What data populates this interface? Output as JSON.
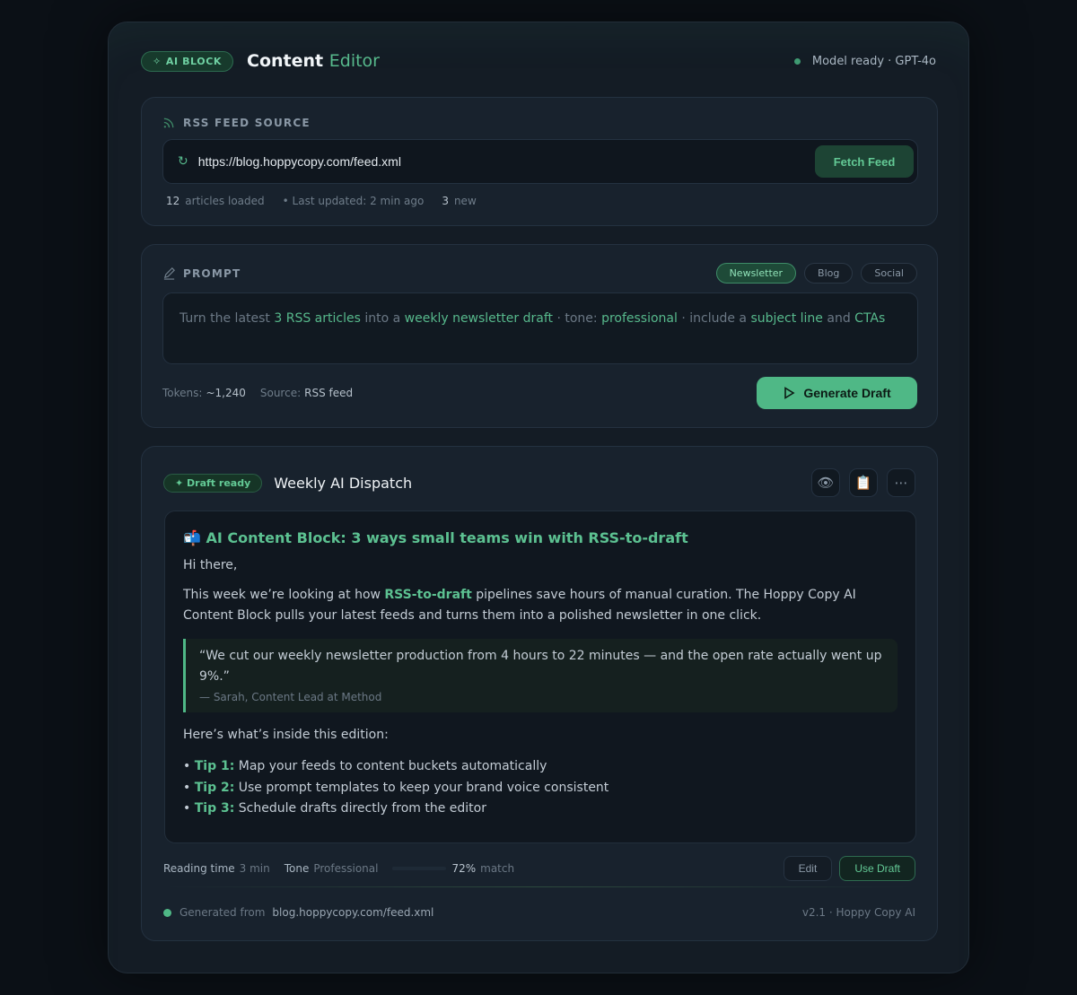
{
  "header": {
    "badge": "AI BLOCK",
    "title_main": "Content",
    "title_accent": "Editor",
    "status": "Model ready · GPT-4o"
  },
  "rss": {
    "label": "RSS FEED SOURCE",
    "url": "https://blog.hoppycopy.com/feed.xml",
    "fetch_label": "Fetch Feed",
    "articles_count": "12",
    "articles_text": "articles loaded",
    "updated": "• Last updated: 2 min ago",
    "new_count": "3",
    "new_text": "new"
  },
  "prompt": {
    "label": "PROMPT",
    "chips": [
      "Newsletter",
      "Blog",
      "Social"
    ],
    "active_chip": "Newsletter",
    "text": {
      "p1": "Turn the latest ",
      "h1": "3 RSS articles",
      "p2": " into a ",
      "h2": "weekly newsletter draft",
      "p3": " · tone: ",
      "h3": "professional",
      "p4": " · include a ",
      "h4": "subject line",
      "p5": " and ",
      "h5": "CTAs"
    },
    "tokens_label": "Tokens:",
    "tokens_value": "~1,240",
    "source_label": "Source:",
    "source_value": "RSS feed",
    "generate_label": "Generate Draft"
  },
  "draft": {
    "badge": "✦ Draft ready",
    "title": "Weekly AI Dispatch",
    "icons": [
      "eye-icon",
      "clipboard-icon",
      "more-icon"
    ],
    "heading": "📬 AI Content Block: 3 ways small teams win with RSS-to-draft",
    "greeting": "Hi there,",
    "body_pre": "This week we’re looking at how ",
    "body_bold": "RSS-to-draft",
    "body_post": " pipelines save hours of manual curation. The Hoppy Copy AI Content Block pulls your latest feeds and turns them into a polished newsletter in one click.",
    "quote": "“We cut our weekly newsletter production from 4 hours to 22 minutes — and the open rate actually went up 9%.”",
    "quote_author": "— Sarah, Content Lead at Method",
    "inside": "Here’s what’s inside this edition:",
    "tips": [
      {
        "label": "Tip 1:",
        "text": " Map your feeds to content buckets automatically"
      },
      {
        "label": "Tip 2:",
        "text": " Use prompt templates to keep your brand voice consistent"
      },
      {
        "label": "Tip 3:",
        "text": " Schedule drafts directly from the editor"
      }
    ],
    "reading_label": "Reading time",
    "reading_value": "3 min",
    "tone_label": "Tone",
    "tone_value": "Professional",
    "match_pct": "72%",
    "match_fraction": 0.72,
    "match_text": "match",
    "edit_label": "Edit",
    "use_label": "Use Draft",
    "generated_label": "Generated from",
    "generated_src": "blog.hoppycopy.com/feed.xml",
    "version": "v2.1 · Hoppy Copy AI"
  },
  "colors": {
    "accent": "#57b98c",
    "background": "#0b1016",
    "card": "#18222d"
  }
}
